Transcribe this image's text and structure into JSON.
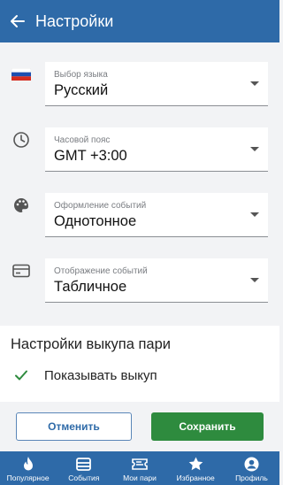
{
  "appbar": {
    "title": "Настройки"
  },
  "settings": [
    {
      "label": "Выбор языка",
      "value": "Русский",
      "icon": "russia-flag-icon"
    },
    {
      "label": "Часовой пояс",
      "value": "GMT +3:00",
      "icon": "clock-icon"
    },
    {
      "label": "Оформление событий",
      "value": "Однотонное",
      "icon": "palette-icon"
    },
    {
      "label": "Отображение событий",
      "value": "Табличное",
      "icon": "card-icon"
    }
  ],
  "buyout": {
    "heading": "Настройки выкупа пари",
    "option": "Показывать выкуп",
    "checked": true
  },
  "actions": {
    "cancel": "Отменить",
    "save": "Сохранить"
  },
  "nav": [
    {
      "label": "Популярное",
      "icon": "flame-icon"
    },
    {
      "label": "События",
      "icon": "events-icon"
    },
    {
      "label": "Мои пари",
      "icon": "ticket-icon"
    },
    {
      "label": "Избранное",
      "icon": "star-icon"
    },
    {
      "label": "Профиль",
      "icon": "profile-icon"
    }
  ],
  "colors": {
    "primary": "#2e6aa8",
    "save": "#2e8b3e",
    "check": "#2e8b3e"
  }
}
